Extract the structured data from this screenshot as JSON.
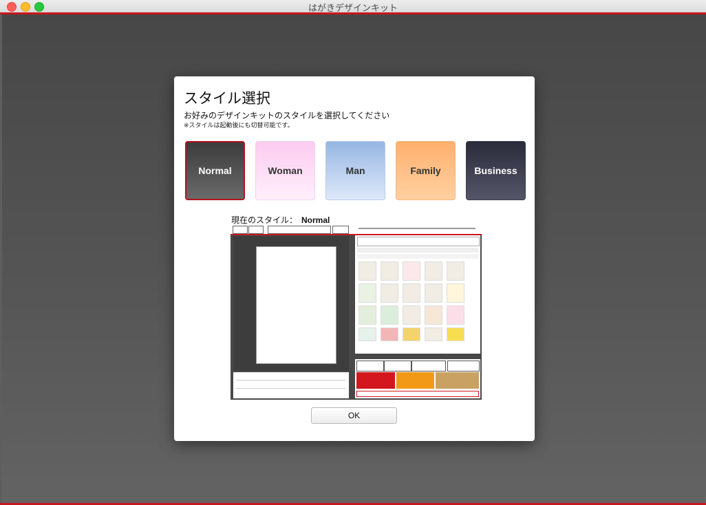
{
  "window": {
    "title": "はがきデザインキット"
  },
  "dialog": {
    "title": "スタイル選択",
    "description": "お好みのデザインキットのスタイルを選択してください",
    "note": "※スタイルは起動後にも切替可能です。",
    "styles": [
      {
        "label": "Normal",
        "selected": true
      },
      {
        "label": "Woman"
      },
      {
        "label": "Man"
      },
      {
        "label": "Family"
      },
      {
        "label": "Business"
      }
    ],
    "current_label": "現在のスタイル：",
    "current_value": "Normal",
    "ok_label": "OK"
  },
  "colors": {
    "accent": "#c8161d",
    "backdrop": "#555555"
  }
}
